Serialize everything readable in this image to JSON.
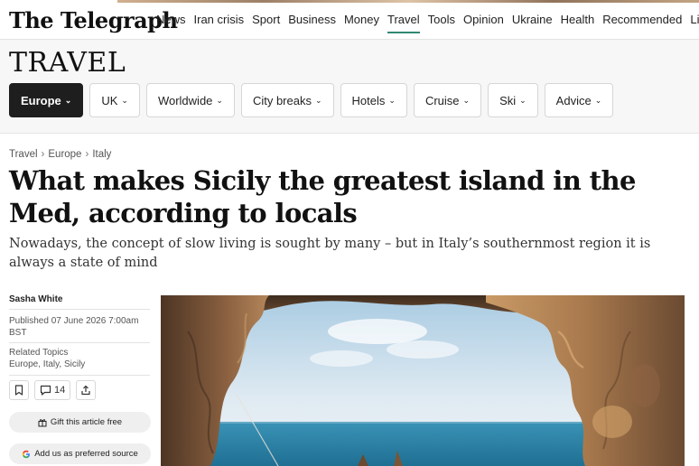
{
  "brand": {
    "logo_text": "The Telegraph"
  },
  "nav": {
    "items": [
      {
        "label": "News"
      },
      {
        "label": "Iran crisis"
      },
      {
        "label": "Sport"
      },
      {
        "label": "Business"
      },
      {
        "label": "Money"
      },
      {
        "label": "Travel",
        "active": true
      },
      {
        "label": "Tools"
      },
      {
        "label": "Opinion"
      },
      {
        "label": "Ukraine"
      },
      {
        "label": "Health"
      },
      {
        "label": "Recommended"
      },
      {
        "label": "Lifest"
      }
    ],
    "accent_color": "#2f8a73"
  },
  "section": {
    "title": "TRAVEL",
    "pills": [
      {
        "label": "Europe",
        "active": true
      },
      {
        "label": "UK"
      },
      {
        "label": "Worldwide"
      },
      {
        "label": "City breaks"
      },
      {
        "label": "Hotels"
      },
      {
        "label": "Cruise"
      },
      {
        "label": "Ski"
      },
      {
        "label": "Advice"
      }
    ],
    "chevron_glyph": "⌄"
  },
  "breadcrumb": [
    "Travel",
    "Europe",
    "Italy"
  ],
  "article": {
    "headline": "What makes Sicily the greatest island in the Med, according to locals",
    "standfirst": "Nowadays, the concept of slow living is sought by many – but in Italy’s southernmost region it is always a state of mind",
    "author": "Sasha White",
    "published": "Published 07 June 2026 7:00am BST",
    "topics_label": "Related Topics",
    "topics": "Europe, Italy, Sicily",
    "comment_count": "14",
    "gift_label": "Gift this article free",
    "google_label": "Add us as preferred source"
  },
  "icons": {
    "bookmark": "bookmark-icon",
    "comment": "comment-icon",
    "share": "share-icon",
    "gift": "gift-icon",
    "google": "google-icon"
  },
  "colors": {
    "pill_active_bg": "#1e1e1e",
    "sea": "#2f86a8",
    "sky": "#dceaf4",
    "rock": "#a87a4e"
  }
}
